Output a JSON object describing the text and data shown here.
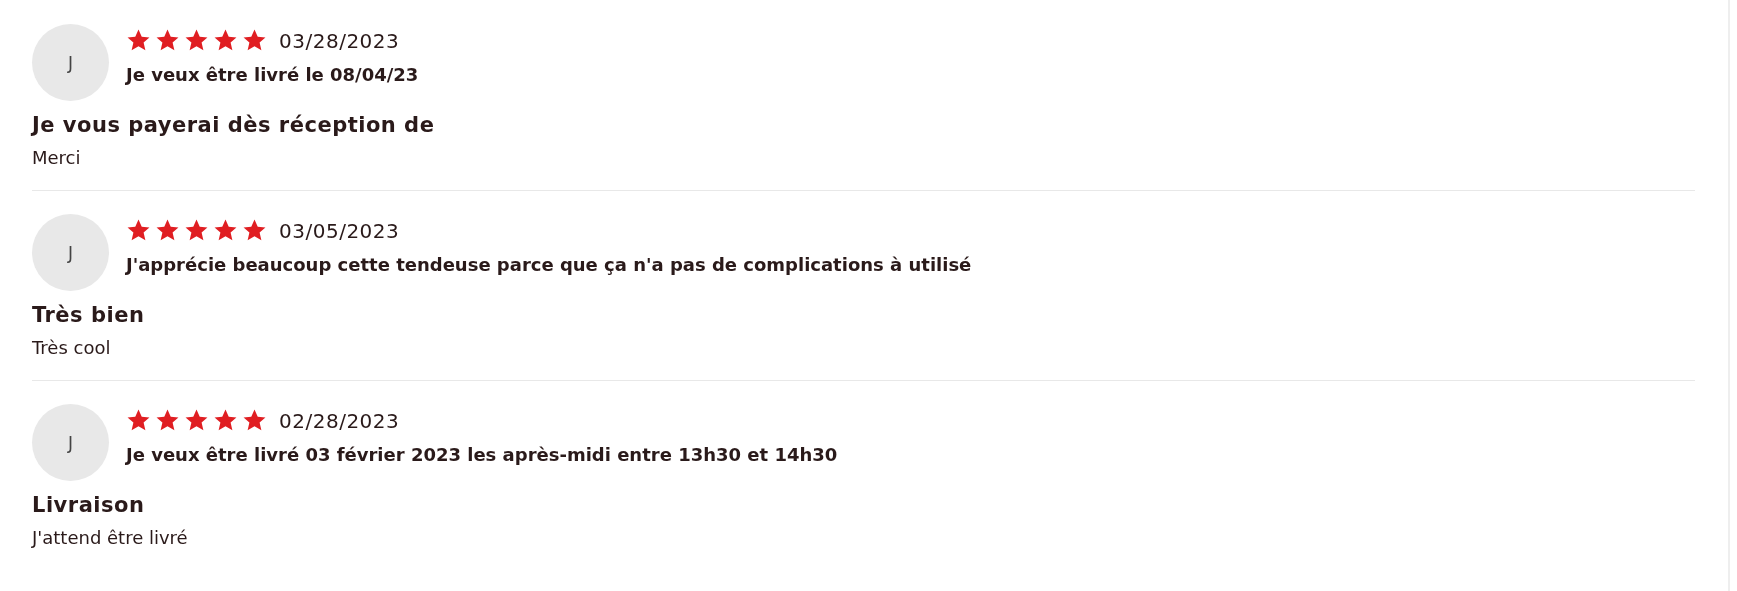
{
  "reviews": [
    {
      "initial": "J",
      "stars": 5,
      "date": "03/28/2023",
      "subtitle": "Je veux être livré le 08/04/23",
      "title": "Je vous payerai dès réception de",
      "body": "Merci"
    },
    {
      "initial": "J",
      "stars": 5,
      "date": "03/05/2023",
      "subtitle": "J'apprécie beaucoup cette tendeuse parce que ça n'a pas de complications à utilisé",
      "title": "Très bien",
      "body": "Très cool"
    },
    {
      "initial": "J",
      "stars": 5,
      "date": "02/28/2023",
      "subtitle": "Je veux être livré 03 février 2023 les après-midi entre 13h30 et 14h30",
      "title": "Livraison",
      "body": "J'attend être livré"
    }
  ]
}
